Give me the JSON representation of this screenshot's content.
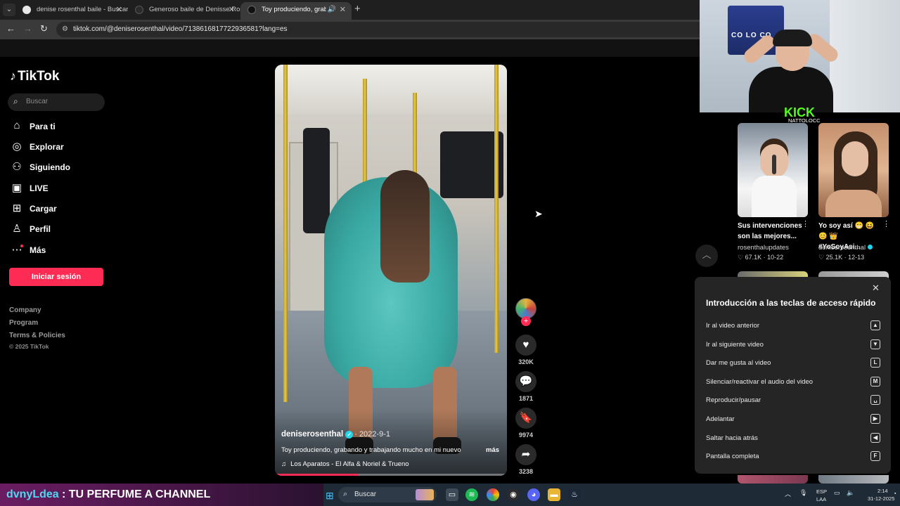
{
  "browser": {
    "tabs": [
      {
        "title": "denise rosenthal baile - Buscar",
        "favicon_color": "#e7e7e7"
      },
      {
        "title": "Generoso baile de Denisse Rosenthal",
        "favicon_color": "#2b2b2b"
      },
      {
        "title": "Toy produciendo, grabando y trabajando",
        "favicon_color": "#111111"
      }
    ],
    "active_tab": 2,
    "new_tab_icon": "+",
    "url": "tiktok.com/@deniserosenthal/video/7138616817722936581?lang=es"
  },
  "tiktok": {
    "logo_text": "TikTok",
    "search_placeholder": "Buscar",
    "nav": [
      {
        "label": "Para ti",
        "icon": "home-icon",
        "glyph": "⌂"
      },
      {
        "label": "Explorar",
        "icon": "compass-icon",
        "glyph": "◎"
      },
      {
        "label": "Siguiendo",
        "icon": "following-icon",
        "glyph": "⚇"
      },
      {
        "label": "LIVE",
        "icon": "live-icon",
        "glyph": "▣"
      },
      {
        "label": "Cargar",
        "icon": "upload-icon",
        "glyph": "⊞"
      },
      {
        "label": "Perfil",
        "icon": "profile-icon",
        "glyph": "♙"
      },
      {
        "label": "Más",
        "icon": "more-icon",
        "glyph": "⋯"
      }
    ],
    "login_label": "Iniciar sesión",
    "footer_links": [
      "Company",
      "Program",
      "Terms & Policies"
    ],
    "copyright": "© 2025 TikTok",
    "accent": "#fe2c55"
  },
  "video": {
    "author": "deniserosenthal",
    "date": "2022-9-1",
    "description": "Toy produciendo, grabando y trabajando mucho en mi nuevo",
    "more_label": "más",
    "music": "Los Aparatos - El Alfa & Noriel & Trueno",
    "progress": 0.36,
    "likes": "320K",
    "comments": "1871",
    "saves": "9974",
    "shares": "3238"
  },
  "recommendations": [
    {
      "title": "Sus intervenciones son las mejores...",
      "author": "rosenthalupdates",
      "likes": "67.1K",
      "date": "10-22",
      "verified": false
    },
    {
      "title": "Yo soy así 😁 😆 😊 👑 #YoSoyAsi...",
      "author": "deniserosenthal",
      "likes": "25.1K",
      "date": "12-13",
      "verified": true
    }
  ],
  "shortcuts": {
    "title": "Introducción a las teclas de acceso rápido",
    "items": [
      {
        "label": "Ir al video anterior",
        "key": "▲"
      },
      {
        "label": "Ir al siguiente video",
        "key": "▼"
      },
      {
        "label": "Dar me gusta al video",
        "key": "L"
      },
      {
        "label": "Silenciar/reactivar el audio del video",
        "key": "M"
      },
      {
        "label": "Reproducir/pausar",
        "key": "␣"
      },
      {
        "label": "Adelantar",
        "key": "▶"
      },
      {
        "label": "Saltar hacia atrás",
        "key": "◀"
      },
      {
        "label": "Pantalla completa",
        "key": "F"
      }
    ]
  },
  "stream": {
    "kick_logo": "KICK",
    "kick_channel": "NATTOLOCC",
    "marquee_user": "dvnyLdea",
    "marquee_message": ": TU PERFUME A CHANNEL",
    "cam_flag_text": "CO LO CO"
  },
  "taskbar": {
    "search_placeholder": "Buscar",
    "language_top": "ESP",
    "language_bottom": "LAA",
    "time": "2:14",
    "date": "31-12-2025"
  }
}
